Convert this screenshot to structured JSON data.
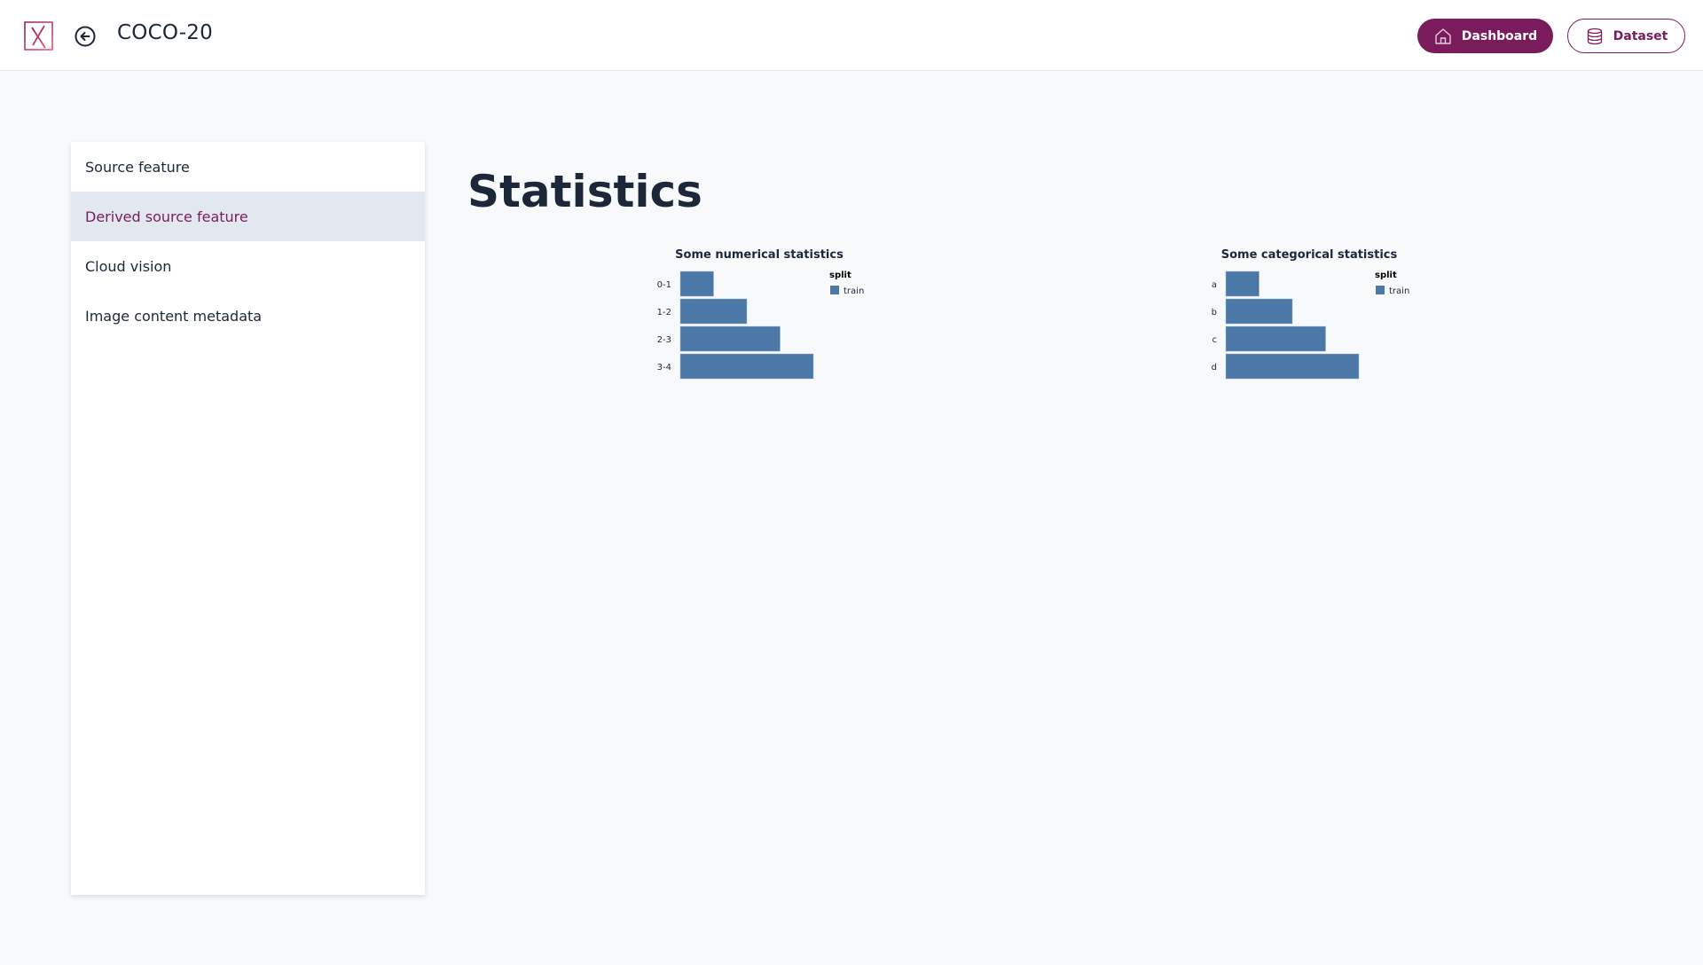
{
  "header": {
    "logo_icon": "x-logo-icon",
    "back_icon": "arrow-left-circle-icon",
    "title": "COCO-20",
    "buttons": [
      {
        "label": "Dashboard",
        "icon": "home-icon"
      },
      {
        "label": "Dataset",
        "icon": "database-icon"
      }
    ]
  },
  "colors": {
    "brand": "#7a1c5c",
    "bar": "#4c78a8",
    "active_bg": "#e2e8f0"
  },
  "sidebar": {
    "items": [
      {
        "label": "Source feature",
        "active": false
      },
      {
        "label": "Derived source feature",
        "active": true
      },
      {
        "label": "Cloud vision",
        "active": false
      },
      {
        "label": "Image content metadata",
        "active": false
      }
    ]
  },
  "main": {
    "title": "Statistics"
  },
  "chart_data": [
    {
      "type": "bar",
      "orientation": "horizontal",
      "title": "Some numerical statistics",
      "categories": [
        "0-1",
        "1-2",
        "2-3",
        "3-4"
      ],
      "series": [
        {
          "name": "train",
          "values": [
            1,
            2,
            3,
            4
          ]
        }
      ],
      "legend": {
        "title": "split",
        "entries": [
          "train"
        ],
        "placement": "right"
      },
      "xlabel": "",
      "ylabel": "",
      "xlim": [
        0,
        4
      ],
      "grid": false
    },
    {
      "type": "bar",
      "orientation": "horizontal",
      "title": "Some categorical statistics",
      "categories": [
        "a",
        "b",
        "c",
        "d"
      ],
      "series": [
        {
          "name": "train",
          "values": [
            1,
            2,
            3,
            4
          ]
        }
      ],
      "legend": {
        "title": "split",
        "entries": [
          "train"
        ],
        "placement": "right"
      },
      "xlabel": "",
      "ylabel": "",
      "xlim": [
        0,
        4
      ],
      "grid": false
    }
  ]
}
